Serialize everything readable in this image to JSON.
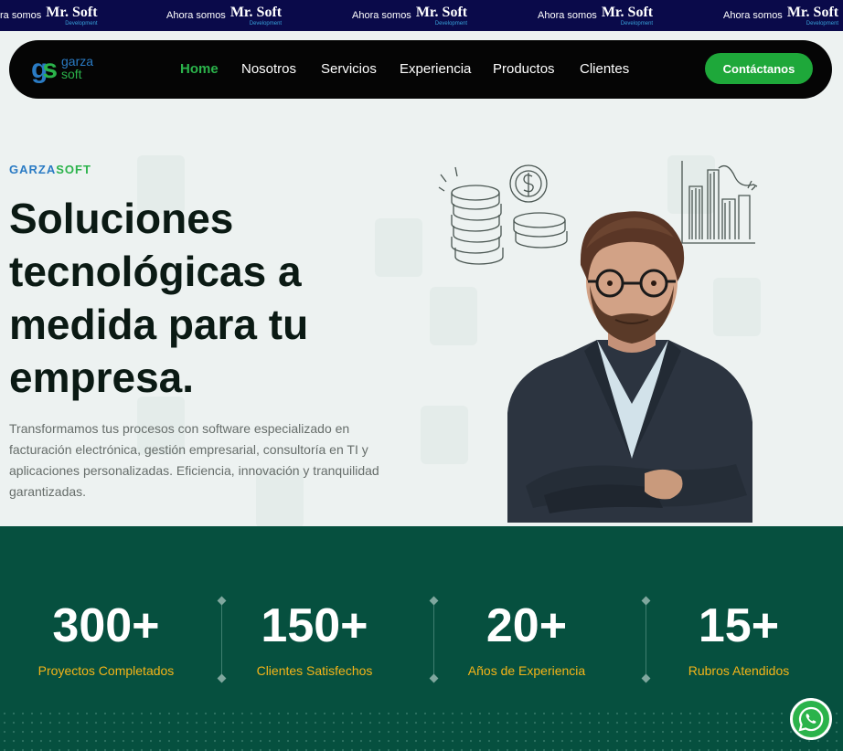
{
  "ticker": {
    "prefix": "Ahora somos",
    "first_prefix": "ra somos",
    "brand": "Mr. Soft",
    "sub": "Development"
  },
  "nav": {
    "logo_line1": "garza",
    "logo_line2": "soft",
    "items": [
      "Home",
      "Nosotros",
      "Servicios",
      "Experiencia",
      "Productos",
      "Clientes"
    ],
    "active": "Home",
    "cta": "Contáctanos"
  },
  "hero": {
    "brand_part1": "GARZA",
    "brand_part2": "SOFT",
    "headline": "Soluciones tecnológicas a medida para tu empresa.",
    "description": "Transformamos tus procesos con software especializado en facturación electrónica, gestión empresarial, consultoría en TI y aplicaciones personalizadas. Eficiencia, innovación y tranquilidad garantizadas."
  },
  "stats": [
    {
      "value": "300+",
      "label": "Proyectos Completados"
    },
    {
      "value": "150+",
      "label": "Clientes Satisfechos"
    },
    {
      "value": "20+",
      "label": "Años de Experiencia"
    },
    {
      "value": "15+",
      "label": "Rubros Atendidos"
    }
  ],
  "colors": {
    "accent_green": "#2bb34b",
    "brand_blue": "#2a7bc4",
    "stats_bg": "#06503f",
    "stat_label": "#f5b418",
    "ticker_bg": "#0a0a4a"
  },
  "icons": {
    "whatsapp": "whatsapp-icon"
  }
}
